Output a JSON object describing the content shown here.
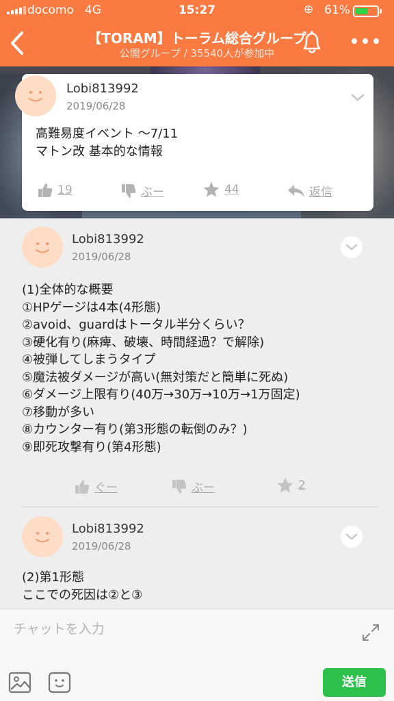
{
  "status_bar": {
    "carrier": "docomo",
    "network": "4G",
    "time": "15:27",
    "battery": "61%",
    "battery_level": 0.61
  },
  "header": {
    "title": "【TORAM】トーラム総合グループ",
    "subtitle": "公開グループ / 35540人が参加中",
    "icons": [
      "back-icon",
      "bell-icon",
      "more-icon"
    ]
  },
  "pinned": {
    "user": "Lobi813992",
    "date": "2019/06/28",
    "body": "高難易度イベント 〜7/11\nマトン改 基本的な情報",
    "likes": "19",
    "dislike": "ぶー",
    "stars": "44",
    "reply": "返信"
  },
  "posts": [
    {
      "user": "Lobi813992",
      "date": "2019/06/28",
      "body": "(1)全体的な概要\n①HPゲージは4本(4形態)\n②avoid、guardはトータル半分くらい？\n③硬化有り(麻痺、破壊、時間経過？で解除)\n④被弾してしまうタイプ\n⑤魔法被ダメージが高い(無対策だと簡単に死ぬ)\n⑥ダメージ上限有り(40万→30万→10万→1万固定)\n⑦移動が多い\n⑧カウンター有り(第3形態の転倒のみ？)\n⑨即死攻撃有り(第4形態)",
      "like": "ぐー",
      "dislike": "ぶー",
      "stars": "2"
    },
    {
      "user": "Lobi813992",
      "date": "2019/06/28",
      "body": "(2)第1形態\nここでの死因は②と③"
    }
  ],
  "composer": {
    "placeholder": "チャットを入力",
    "send": "送信"
  },
  "colors": {
    "header": "#fa7a41",
    "send": "#2dc04c",
    "avatar": "#ffdcc6"
  }
}
